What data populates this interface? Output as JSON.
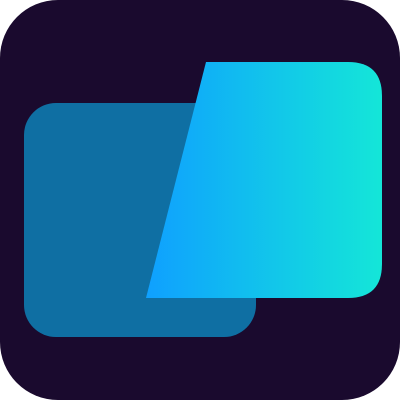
{
  "icon": {
    "name": "app-icon",
    "colors": {
      "background": "#1a0a2e",
      "back_panel": "#0f6fa3",
      "front_gradient_start": "#0fa0ff",
      "front_gradient_end": "#14e6d8"
    }
  }
}
